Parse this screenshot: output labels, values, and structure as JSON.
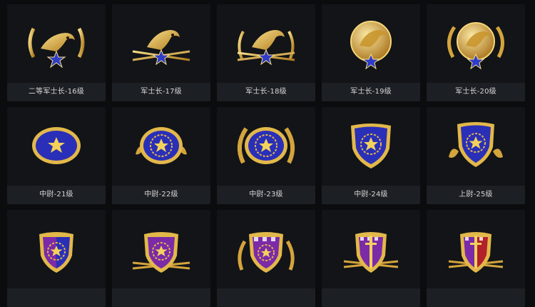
{
  "badges": [
    {
      "label": "二等军士长-16级",
      "icon": "eagle-wreath-icon"
    },
    {
      "label": "军士长-17级",
      "icon": "eagle-arrows-icon"
    },
    {
      "label": "军士长-18级",
      "icon": "eagle-wreath-arrows-icon"
    },
    {
      "label": "军士长-19级",
      "icon": "eagle-medallion-icon"
    },
    {
      "label": "军士长-20级",
      "icon": "eagle-medallion-wreath-icon"
    },
    {
      "label": "中尉-21级",
      "icon": "star-oval-icon"
    },
    {
      "label": "中尉-22级",
      "icon": "star-oval-leaves-icon"
    },
    {
      "label": "中尉-23级",
      "icon": "star-oval-wreath-icon"
    },
    {
      "label": "中尉-24级",
      "icon": "star-shield-icon"
    },
    {
      "label": "上尉-25级",
      "icon": "star-shield-leaves-icon"
    },
    {
      "label": "",
      "icon": "star-shield-checker-icon"
    },
    {
      "label": "",
      "icon": "star-shield-purple-arrows-icon"
    },
    {
      "label": "",
      "icon": "star-shield-purple-checker-wreath-icon"
    },
    {
      "label": "",
      "icon": "sword-shield-purple-icon"
    },
    {
      "label": "",
      "icon": "sword-shield-red-icon"
    }
  ],
  "colors": {
    "background": "#0b0c0e",
    "card": "#121417",
    "label_bar": "#1c1f24",
    "gold": "#e2b84a",
    "blue": "#2a2fb8",
    "purple": "#7b2aa8",
    "red": "#b3202a"
  }
}
